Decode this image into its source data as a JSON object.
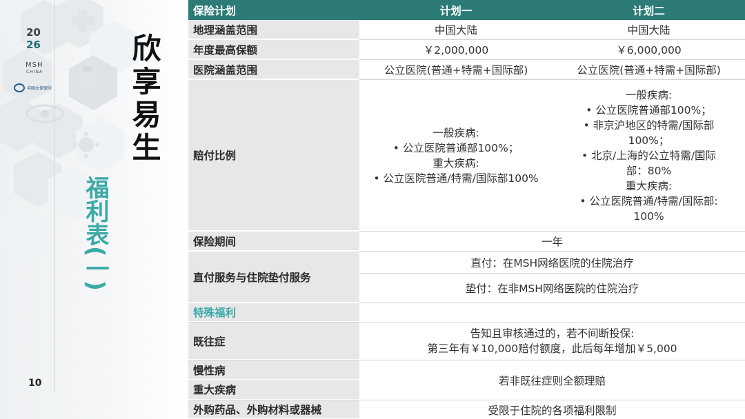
{
  "sidebar": {
    "year_top": "20",
    "year_bottom": "26",
    "brand": "MSH",
    "brand_sub": "CHINA",
    "partner": "中国太保保险",
    "title": "欣享易生",
    "subtitle": "福利表(一)",
    "page_number": "10"
  },
  "table": {
    "header": {
      "label": "保险计划",
      "plan1": "计划一",
      "plan2": "计划二"
    },
    "geo": {
      "label": "地理涵盖范围",
      "plan1": "中国大陆",
      "plan2": "中国大陆"
    },
    "annual": {
      "label": "年度最高保额",
      "plan1": "￥2,000,000",
      "plan2": "￥6,000,000"
    },
    "hospital": {
      "label": "医院涵盖范围",
      "plan1": "公立医院(普通+特需+国际部)",
      "plan2": "公立医院(普通+特需+国际部)"
    },
    "ratio": {
      "label": "赔付比例",
      "plan1": [
        "一般疾病:",
        "• 公立医院普通部100%；",
        "重大疾病:",
        "• 公立医院普通/特需/国际部100%"
      ],
      "plan2": [
        "一般疾病:",
        "• 公立医院普通部100%；",
        "• 非京沪地区的特需/国际部",
        "100%；",
        "• 北京/上海的公立特需/国际",
        "部：80%",
        "重大疾病:",
        "• 公立医院普通/特需/国际部:",
        "100%"
      ]
    },
    "period": {
      "label": "保险期间",
      "value": "一年"
    },
    "direct": {
      "label": "直付服务与住院垫付服务",
      "line1": "直付：在MSH网络医院的住院治疗",
      "line2": "垫付：在非MSH网络医院的住院治疗"
    },
    "special": {
      "label": "特殊福利"
    },
    "preexisting": {
      "label": "既往症",
      "line1": "告知且审核通过的，若不间断投保:",
      "line2": "第三年有￥10,000赔付额度，此后每年增加￥5,000"
    },
    "chronic": {
      "label": "慢性病"
    },
    "critical": {
      "label": "重大疾病",
      "value": "若非既往症则全额理赔"
    },
    "external": {
      "label": "外购药品、外购材料或器械",
      "value": "受限于住院的各项福利限制"
    }
  }
}
